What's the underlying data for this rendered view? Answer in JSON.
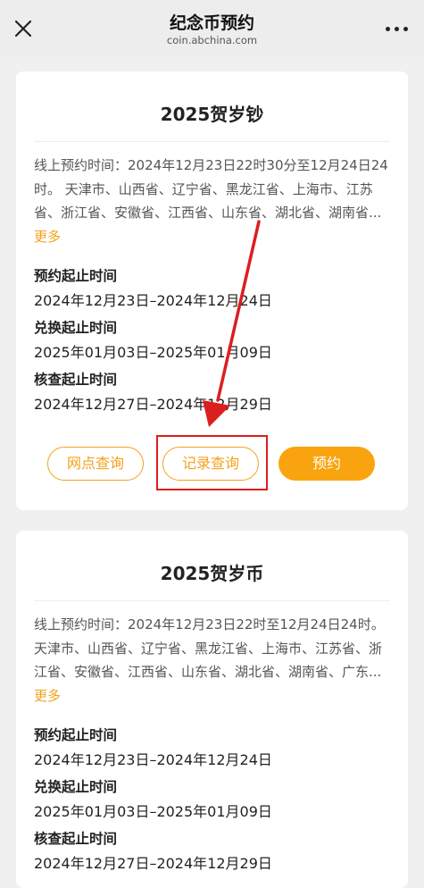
{
  "header": {
    "title": "纪念币预约",
    "subtitle": "coin.abchina.com"
  },
  "cards": [
    {
      "title": "2025贺岁钞",
      "description": "线上预约时间：2024年12月23日22时30分至12月24日24时。 天津市、山西省、辽宁省、黑龙江省、上海市、江苏省、浙江省、安徽省、江西省、山东省、湖北省、湖南省...",
      "more_label": "更多",
      "fields": [
        {
          "label": "预约起止时间",
          "value": "2024年12月23日–2024年12月24日"
        },
        {
          "label": "兑换起止时间",
          "value": "2025年01月03日–2025年01月09日"
        },
        {
          "label": "核查起止时间",
          "value": "2024年12月27日–2024年12月29日"
        }
      ],
      "buttons": {
        "branch_query": "网点查询",
        "record_query": "记录查询",
        "reserve": "预约"
      }
    },
    {
      "title": "2025贺岁币",
      "description": "线上预约时间：2024年12月23日22时至12月24日24时。 天津市、山西省、辽宁省、黑龙江省、上海市、江苏省、浙江省、安徽省、江西省、山东省、湖北省、湖南省、广东...",
      "more_label": "更多",
      "fields": [
        {
          "label": "预约起止时间",
          "value": "2024年12月23日–2024年12月24日"
        },
        {
          "label": "兑换起止时间",
          "value": "2025年01月03日–2025年01月09日"
        },
        {
          "label": "核查起止时间",
          "value": "2024年12月27日–2024年12月29日"
        }
      ]
    }
  ],
  "colors": {
    "accent": "#f9a40f",
    "annotation_red": "#dc1e1e"
  }
}
